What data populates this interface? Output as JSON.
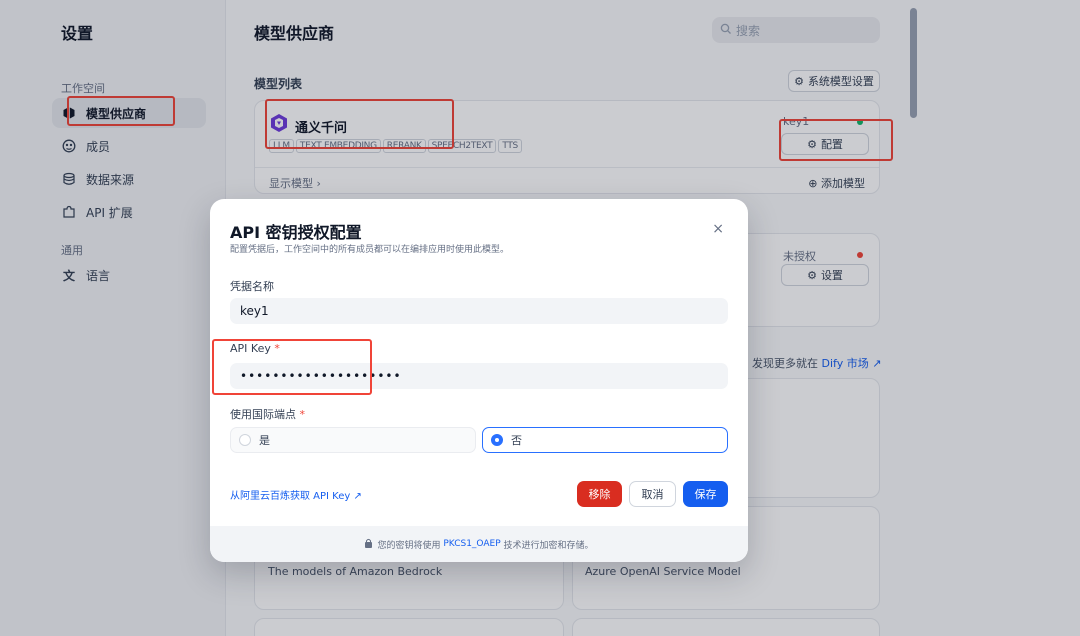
{
  "sidebar": {
    "title": "设置",
    "group_workspace": "工作空间",
    "items": [
      {
        "label": "模型供应商",
        "icon": "cube-icon"
      },
      {
        "label": "成员",
        "icon": "users-icon"
      },
      {
        "label": "数据来源",
        "icon": "database-icon"
      },
      {
        "label": "API 扩展",
        "icon": "puzzle-icon"
      }
    ],
    "group_general": "通用",
    "language": {
      "label": "语言",
      "icon": "translate-icon"
    }
  },
  "main": {
    "title": "模型供应商",
    "search_placeholder": "搜索",
    "section_title": "模型列表",
    "system_settings_label": "系统模型设置",
    "provider": {
      "name": "通义千问",
      "tags": [
        "LLM",
        "TEXT EMBEDDING",
        "RERANK",
        "SPEECH2TEXT",
        "TTS"
      ],
      "key_name": "key1",
      "config_label": "配置",
      "show_models": "显示模型",
      "add_model": "添加模型"
    },
    "provider2": {
      "status": "未授权",
      "setup_label": "设置"
    },
    "market_prefix": "发现更多就在",
    "market_link": "Dify 市场",
    "card_bedrock_desc": "The models of Amazon Bedrock",
    "card_azure_desc": "Azure OpenAI Service Model"
  },
  "modal": {
    "title": "API 密钥授权配置",
    "subtitle": "配置凭据后，工作空间中的所有成员都可以在编排应用时使用此模型。",
    "credential_label": "凭据名称",
    "credential_value": "key1",
    "apikey_label": "API Key",
    "apikey_value": "••••••••••••••••••••",
    "endpoint_label": "使用国际端点",
    "option_yes": "是",
    "option_no": "否",
    "get_key_link": "从阿里云百炼获取 API Key",
    "remove_label": "移除",
    "cancel_label": "取消",
    "save_label": "保存",
    "footer_prefix": "您的密钥将使用",
    "footer_tech": "PKCS1_OAEP",
    "footer_suffix": "技术进行加密和存储。"
  },
  "colors": {
    "primary": "#155eef",
    "danger": "#d92d20",
    "annotation": "#f04438"
  }
}
